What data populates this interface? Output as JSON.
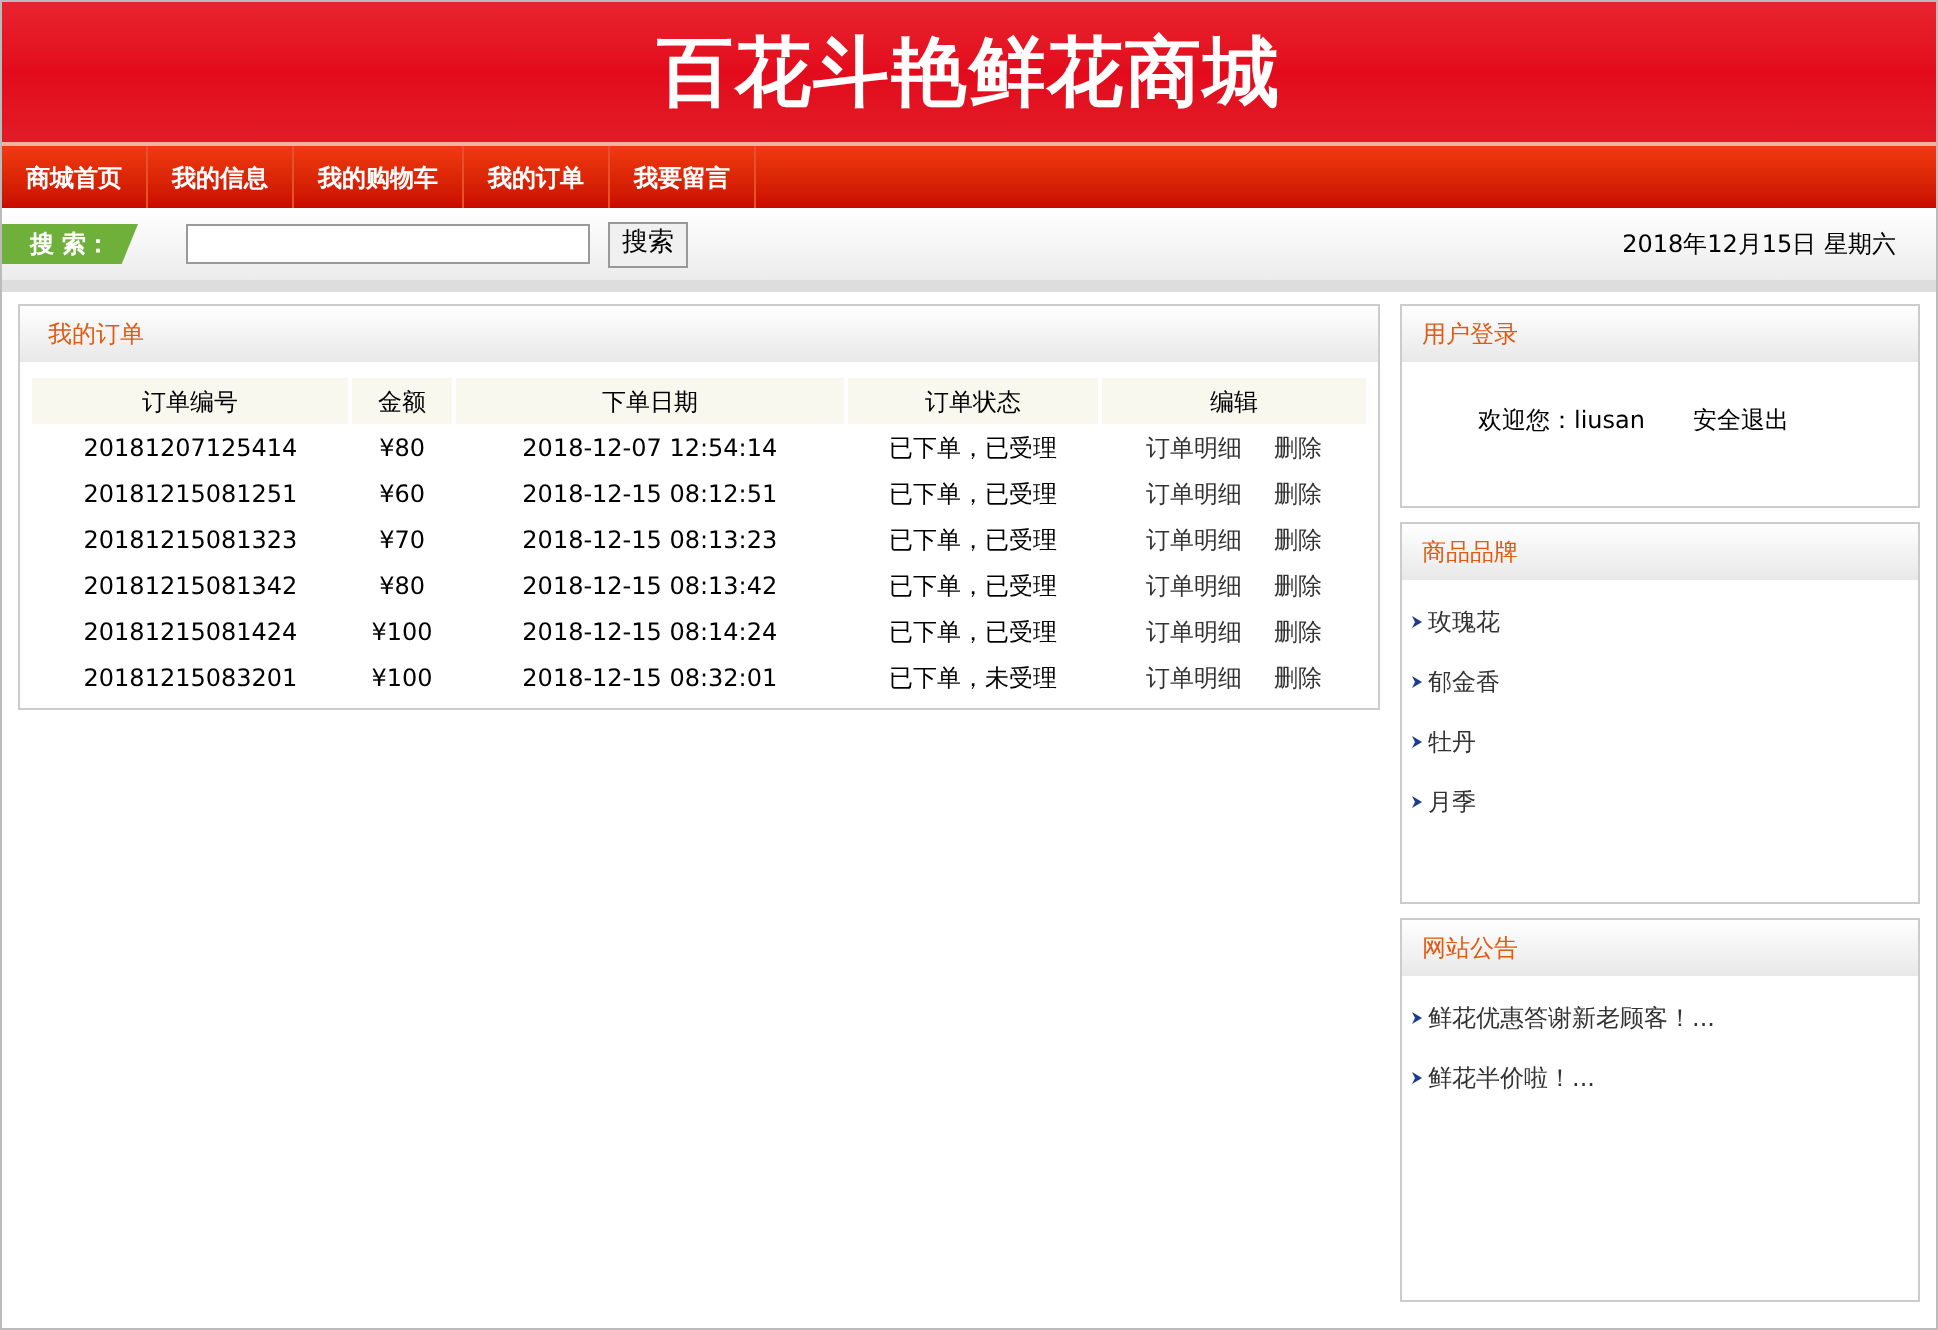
{
  "site_title": "百花斗艳鲜花商城",
  "nav": [
    {
      "label": "商城首页"
    },
    {
      "label": "我的信息"
    },
    {
      "label": "我的购物车"
    },
    {
      "label": "我的订单"
    },
    {
      "label": "我要留言"
    }
  ],
  "search": {
    "label": "搜 索：",
    "button": "搜索"
  },
  "date": "2018年12月15日 星期六",
  "orders": {
    "title": "我的订单",
    "columns": [
      "订单编号",
      "金额",
      "下单日期",
      "订单状态",
      "编辑"
    ],
    "rows": [
      {
        "id": "20181207125414",
        "amount": "¥80",
        "date": "2018-12-07 12:54:14",
        "status": "已下单，已受理",
        "detail": "订单明细",
        "delete": "删除"
      },
      {
        "id": "20181215081251",
        "amount": "¥60",
        "date": "2018-12-15 08:12:51",
        "status": "已下单，已受理",
        "detail": "订单明细",
        "delete": "删除"
      },
      {
        "id": "20181215081323",
        "amount": "¥70",
        "date": "2018-12-15 08:13:23",
        "status": "已下单，已受理",
        "detail": "订单明细",
        "delete": "删除"
      },
      {
        "id": "20181215081342",
        "amount": "¥80",
        "date": "2018-12-15 08:13:42",
        "status": "已下单，已受理",
        "detail": "订单明细",
        "delete": "删除"
      },
      {
        "id": "20181215081424",
        "amount": "¥100",
        "date": "2018-12-15 08:14:24",
        "status": "已下单，已受理",
        "detail": "订单明细",
        "delete": "删除"
      },
      {
        "id": "20181215083201",
        "amount": "¥100",
        "date": "2018-12-15 08:32:01",
        "status": "已下单，未受理",
        "detail": "订单明细",
        "delete": "删除"
      }
    ]
  },
  "login": {
    "title": "用户登录",
    "welcome": "欢迎您：liusan",
    "logout": "安全退出"
  },
  "brands": {
    "title": "商品品牌",
    "items": [
      "玫瑰花",
      "郁金香",
      "牡丹",
      "月季"
    ]
  },
  "notices": {
    "title": "网站公告",
    "items": [
      "鲜花优惠答谢新老顾客！...",
      "鲜花半价啦！..."
    ]
  }
}
